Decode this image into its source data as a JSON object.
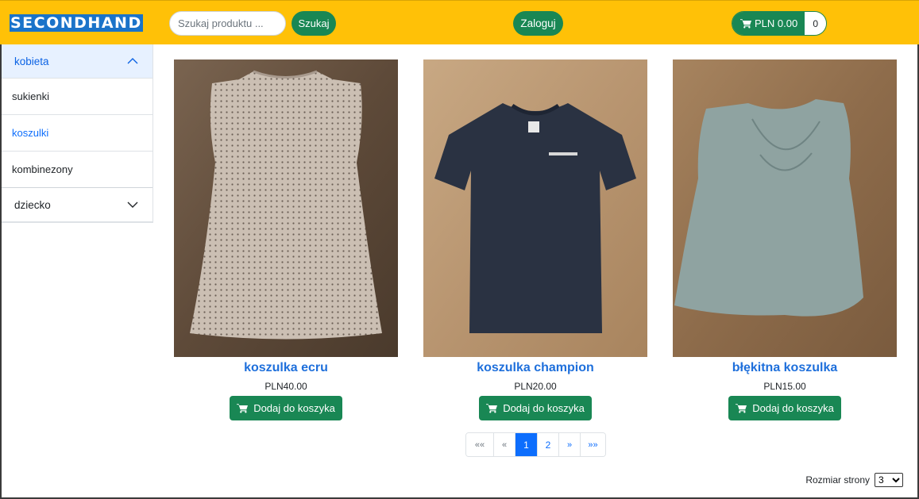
{
  "header": {
    "logo_text": "SECONDHAND",
    "search_placeholder": "Szukaj produktu ...",
    "search_button": "Szukaj",
    "login_button": "Zaloguj",
    "cart_total": "PLN 0.00",
    "cart_count": "0"
  },
  "sidebar": {
    "categories": [
      {
        "label": "kobieta",
        "expanded": true,
        "items": [
          {
            "label": "sukienki",
            "active": false
          },
          {
            "label": "koszulki",
            "active": true
          },
          {
            "label": "kombinezony",
            "active": false
          }
        ]
      },
      {
        "label": "dziecko",
        "expanded": false,
        "items": []
      }
    ]
  },
  "products": [
    {
      "name": "koszulka ecru",
      "price": "PLN40.00",
      "button": "Dodaj do koszyka",
      "image": "cream eyelet sleeveless top on wooden floor"
    },
    {
      "name": "koszulka champion",
      "price": "PLN20.00",
      "button": "Dodaj do koszyka",
      "image": "dark navy champion t-shirt on wooden floor"
    },
    {
      "name": "błękitna koszulka",
      "price": "PLN15.00",
      "button": "Dodaj do koszyka",
      "image": "light blue-grey sleeveless embroidered top on wooden floor"
    }
  ],
  "pagination": {
    "first": "««",
    "prev": "«",
    "pages": [
      "1",
      "2"
    ],
    "current": "1",
    "next": "»",
    "last": "»»"
  },
  "page_size": {
    "label": "Rozmiar strony",
    "selected": "3"
  },
  "colors": {
    "header_bg": "#ffc107",
    "primary_green": "#198754",
    "link_blue": "#0d6efd",
    "logo_bg": "#1a73c9"
  }
}
